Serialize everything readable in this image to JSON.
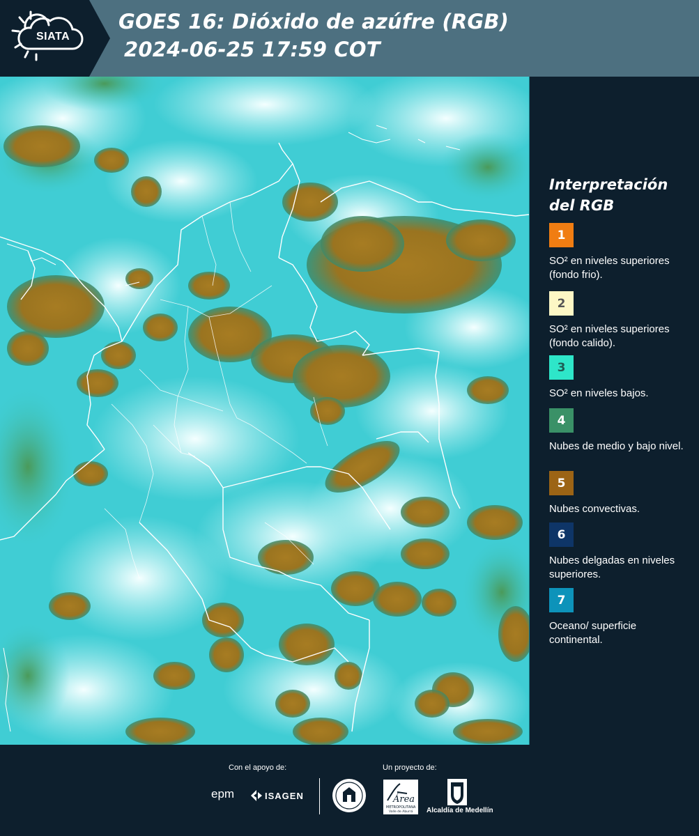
{
  "header": {
    "logo_text": "SIATA",
    "title_line1": "GOES 16: Dióxido de azúfre (RGB)",
    "title_line2": "2024-06-25 17:59 COT"
  },
  "legend": {
    "title_line1": "Interpretación",
    "title_line2": "del RGB",
    "items": [
      {
        "number": "1",
        "color": "#f07d12",
        "text_color": "#ffffff",
        "label": "SO² en niveles superiores (fondo frio)."
      },
      {
        "number": "2",
        "color": "#fdf7c5",
        "text_color": "#555555",
        "label": "SO² en niveles superiores (fondo calido)."
      },
      {
        "number": "3",
        "color": "#2ee6c9",
        "text_color": "#1f5d55",
        "label": "SO² en niveles bajos."
      },
      {
        "number": "4",
        "color": "#3a9167",
        "text_color": "#ffffff",
        "label": "Nubes de medio y bajo nivel."
      },
      {
        "number": "5",
        "color": "#9c6415",
        "text_color": "#ffffff",
        "label": "Nubes convectivas."
      },
      {
        "number": "6",
        "color": "#0e3567",
        "text_color": "#ffffff",
        "label": "Nubes delgadas en niveles superiores."
      },
      {
        "number": "7",
        "color": "#0d93ba",
        "text_color": "#ffffff",
        "label": "Oceano/ superficie continental."
      }
    ]
  },
  "footer": {
    "support_label": "Con el apoyo de:",
    "project_label": "Un proyecto de:",
    "sponsor_epm": "epm",
    "sponsor_isagen": "ISAGEN",
    "area_text": "Área",
    "area_sub": "METROPOLITANA",
    "area_sub2": "Valle de Aburrá",
    "alcaldia": "Alcaldía de Medellín"
  },
  "colors": {
    "header_bg": "#4d7080",
    "logo_bg": "#0d1f2d",
    "page_bg": "#0d1f2d",
    "cloud_cyan": "#3dd0d6",
    "cloud_white": "#e6fbfb",
    "convective_brown": "#a87a1e"
  }
}
